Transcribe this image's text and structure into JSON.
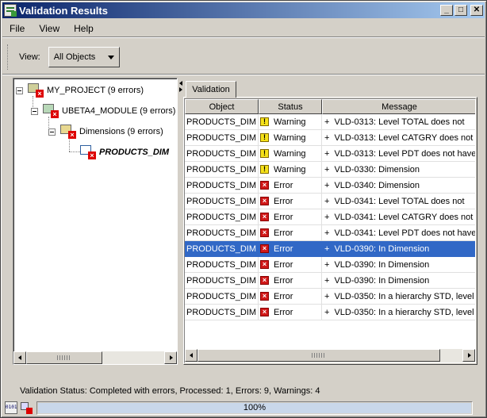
{
  "window": {
    "title": "Validation Results"
  },
  "menu": [
    {
      "label": "File"
    },
    {
      "label": "View"
    },
    {
      "label": "Help"
    }
  ],
  "toolbar": {
    "view_label": "View:",
    "view_value": "All Objects"
  },
  "tree": {
    "project": "MY_PROJECT (9 errors)",
    "module": "UBETA4_MODULE (9 errors)",
    "folder": "Dimensions (9 errors)",
    "object": "PRODUCTS_DIM"
  },
  "tab": {
    "label": "Validation"
  },
  "table": {
    "columns": [
      "Object",
      "Status",
      "Message"
    ],
    "rows": [
      {
        "object": "PRODUCTS_DIM",
        "status": "Warning",
        "message": "VLD-0313: Level TOTAL does not"
      },
      {
        "object": "PRODUCTS_DIM",
        "status": "Warning",
        "message": "VLD-0313: Level CATGRY does not"
      },
      {
        "object": "PRODUCTS_DIM",
        "status": "Warning",
        "message": "VLD-0313: Level PDT does not have"
      },
      {
        "object": "PRODUCTS_DIM",
        "status": "Warning",
        "message": "VLD-0330: Dimension"
      },
      {
        "object": "PRODUCTS_DIM",
        "status": "Error",
        "message": "VLD-0340: Dimension"
      },
      {
        "object": "PRODUCTS_DIM",
        "status": "Error",
        "message": "VLD-0341: Level TOTAL does not"
      },
      {
        "object": "PRODUCTS_DIM",
        "status": "Error",
        "message": "VLD-0341: Level CATGRY does not"
      },
      {
        "object": "PRODUCTS_DIM",
        "status": "Error",
        "message": "VLD-0341: Level PDT does not have"
      },
      {
        "object": "PRODUCTS_DIM",
        "status": "Error",
        "message": "VLD-0390: In Dimension",
        "selected": true
      },
      {
        "object": "PRODUCTS_DIM",
        "status": "Error",
        "message": "VLD-0390: In Dimension"
      },
      {
        "object": "PRODUCTS_DIM",
        "status": "Error",
        "message": "VLD-0390: In Dimension"
      },
      {
        "object": "PRODUCTS_DIM",
        "status": "Error",
        "message": "VLD-0350: In a hierarchy STD, level"
      },
      {
        "object": "PRODUCTS_DIM",
        "status": "Error",
        "message": "VLD-0350: In a hierarchy STD, level"
      }
    ]
  },
  "status": {
    "text": "Validation Status: Completed with errors, Processed: 1, Errors: 9, Warnings: 4",
    "progress_label": "100%",
    "progress_fraction": 1.0,
    "binary_icon_text": "0101"
  },
  "colors": {
    "title_start": "#0a246a",
    "title_end": "#a6caf0",
    "selection": "#3168c6",
    "error": "#d01818",
    "warning": "#f6e21a"
  }
}
